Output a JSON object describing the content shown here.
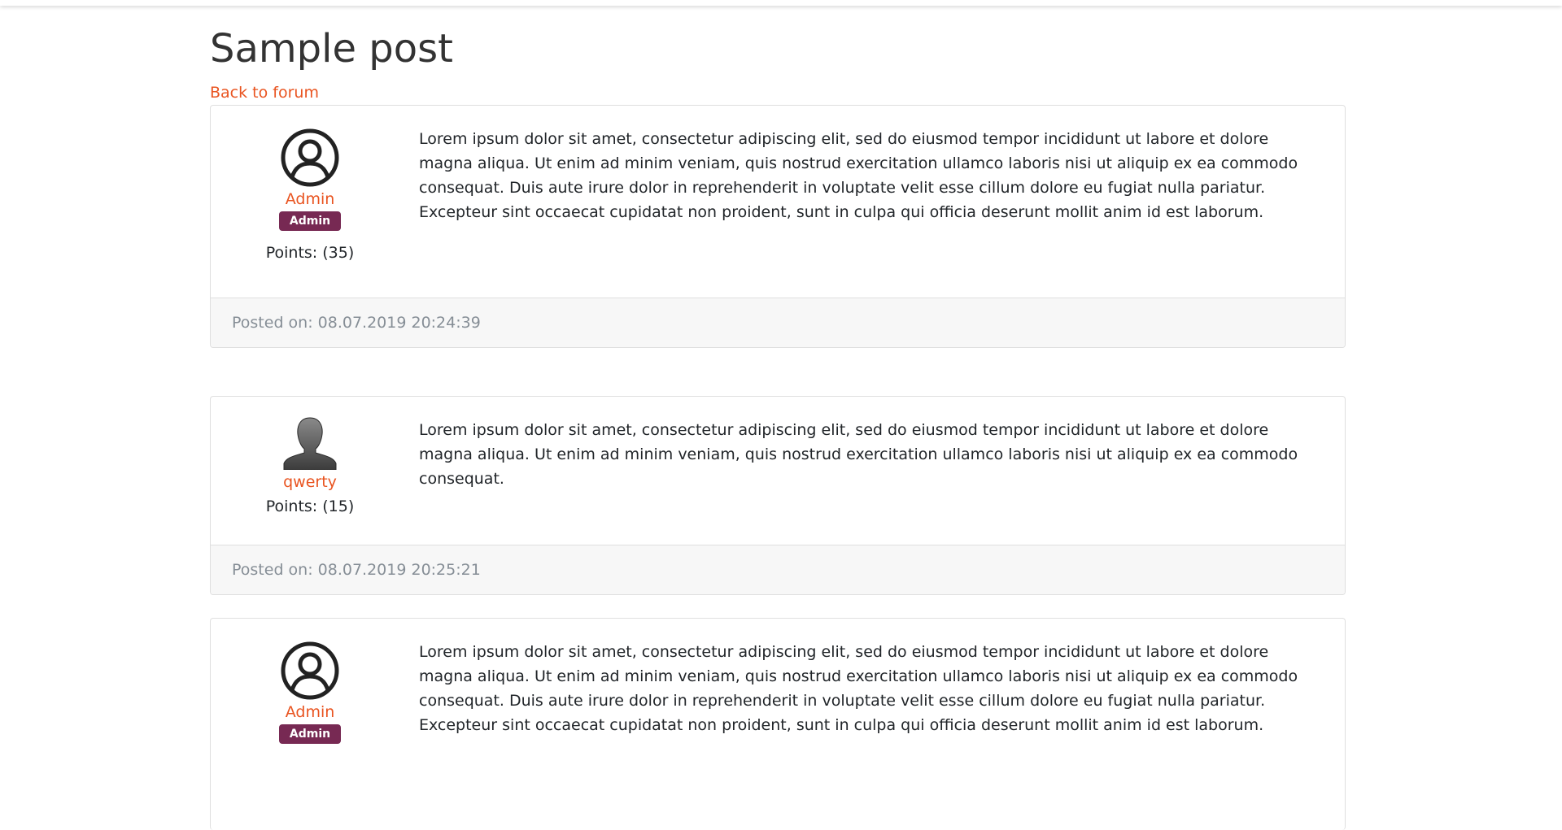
{
  "page": {
    "title": "Sample post",
    "back_link": "Back to forum"
  },
  "colors": {
    "accent": "#e95420",
    "badge": "#772953",
    "footer_text": "#868e96"
  },
  "posts": [
    {
      "author": "Admin",
      "avatar_icon": "user-circle-icon",
      "role": "Admin",
      "points": "Points: (35)",
      "text": "Lorem ipsum dolor sit amet, consectetur adipiscing elit, sed do eiusmod tempor incididunt ut labore et dolore magna aliqua. Ut enim ad minim veniam, quis nostrud exercitation ullamco laboris nisi ut aliquip ex ea commodo consequat. Duis aute irure dolor in reprehenderit in voluptate velit esse cillum dolore eu fugiat nulla pariatur. Excepteur sint occaecat cupidatat non proident, sunt in culpa qui officia deserunt mollit anim id est laborum.",
      "posted_on": "Posted on: 08.07.2019 20:24:39"
    },
    {
      "author": "qwerty",
      "avatar_icon": "user-silhouette-icon",
      "points": "Points: (15)",
      "text": "Lorem ipsum dolor sit amet, consectetur adipiscing elit, sed do eiusmod tempor incididunt ut labore et dolore magna aliqua. Ut enim ad minim veniam, quis nostrud exercitation ullamco laboris nisi ut aliquip ex ea commodo consequat.",
      "posted_on": "Posted on: 08.07.2019 20:25:21"
    },
    {
      "author": "Admin",
      "avatar_icon": "user-circle-icon",
      "role": "Admin",
      "text": "Lorem ipsum dolor sit amet, consectetur adipiscing elit, sed do eiusmod tempor incididunt ut labore et dolore magna aliqua. Ut enim ad minim veniam, quis nostrud exercitation ullamco laboris nisi ut aliquip ex ea commodo consequat. Duis aute irure dolor in reprehenderit in voluptate velit esse cillum dolore eu fugiat nulla pariatur. Excepteur sint occaecat cupidatat non proident, sunt in culpa qui officia deserunt mollit anim id est laborum."
    }
  ]
}
